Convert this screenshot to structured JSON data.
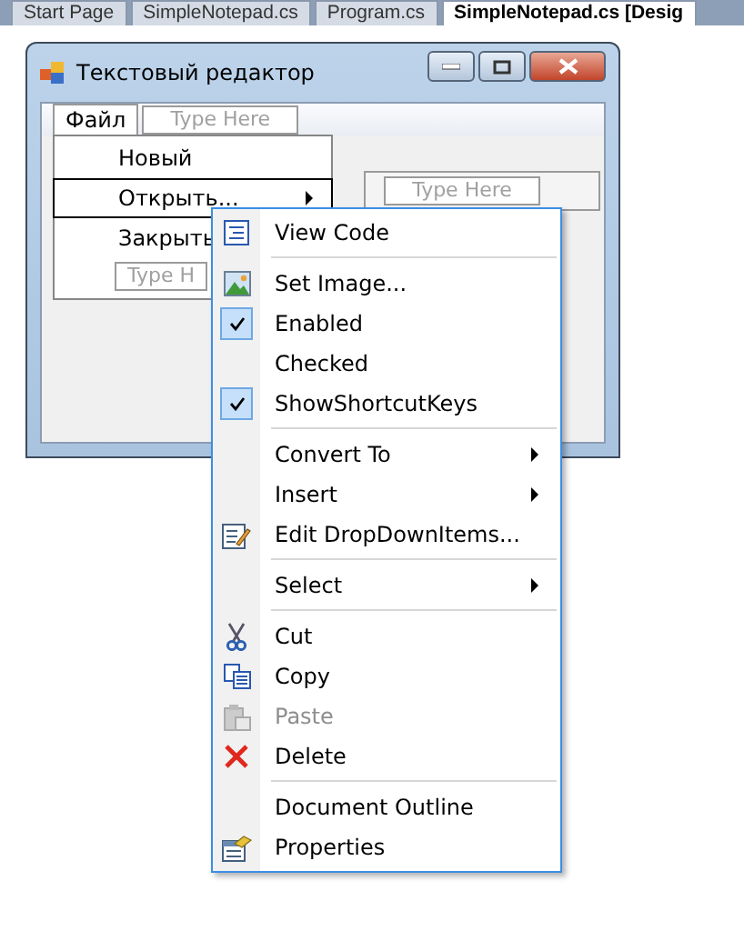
{
  "document_tabs": [
    {
      "label": "Start Page",
      "selected": false
    },
    {
      "label": "SimpleNotepad.cs",
      "selected": false
    },
    {
      "label": "Program.cs",
      "selected": false
    },
    {
      "label": "SimpleNotepad.cs [Desig",
      "selected": true
    }
  ],
  "window": {
    "title": "Текстовый редактор"
  },
  "menu_bar": {
    "items": [
      {
        "label": "Файл",
        "selected": true
      }
    ],
    "placeholder": "Type Here"
  },
  "dropdown": {
    "items": [
      {
        "label": "Новый",
        "selected": false,
        "submenu": false
      },
      {
        "label": "Открыть...",
        "selected": true,
        "submenu": true
      },
      {
        "label": "Закрыть",
        "selected": false,
        "submenu": false
      }
    ],
    "placeholder": "Type H",
    "submenu_placeholder": "Type Here"
  },
  "context_menu": {
    "items": [
      {
        "kind": "command",
        "label": "View Code",
        "disabled": false
      },
      {
        "kind": "separator"
      },
      {
        "kind": "command",
        "label": "Set Image...",
        "disabled": false
      },
      {
        "kind": "check",
        "label": "Enabled",
        "checked": true,
        "disabled": false
      },
      {
        "kind": "check",
        "label": "Checked",
        "checked": false,
        "disabled": false
      },
      {
        "kind": "check",
        "label": "ShowShortcutKeys",
        "checked": true,
        "disabled": false
      },
      {
        "kind": "separator"
      },
      {
        "kind": "submenu",
        "label": "Convert To",
        "disabled": false
      },
      {
        "kind": "submenu",
        "label": "Insert",
        "disabled": false
      },
      {
        "kind": "command",
        "label": "Edit DropDownItems...",
        "disabled": false
      },
      {
        "kind": "separator"
      },
      {
        "kind": "submenu",
        "label": "Select",
        "disabled": false
      },
      {
        "kind": "separator"
      },
      {
        "kind": "command",
        "label": "Cut",
        "disabled": false
      },
      {
        "kind": "command",
        "label": "Copy",
        "disabled": false
      },
      {
        "kind": "command",
        "label": "Paste",
        "disabled": true
      },
      {
        "kind": "command",
        "label": "Delete",
        "disabled": false
      },
      {
        "kind": "separator"
      },
      {
        "kind": "command",
        "label": "Document Outline",
        "disabled": false
      },
      {
        "kind": "command",
        "label": "Properties",
        "disabled": false
      }
    ]
  }
}
